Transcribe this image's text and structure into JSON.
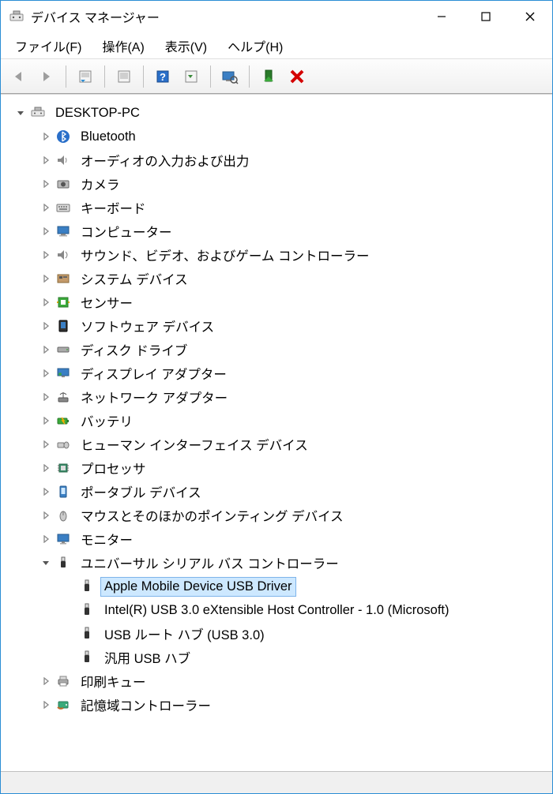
{
  "window": {
    "title": "デバイス マネージャー"
  },
  "menu": {
    "file": "ファイル(F)",
    "action": "操作(A)",
    "view": "表示(V)",
    "help": "ヘルプ(H)"
  },
  "toolbar": {
    "back": "back",
    "forward": "forward",
    "properties1": "properties",
    "properties2": "properties",
    "help": "help",
    "show_hidden": "show-hidden",
    "scan": "scan-hardware",
    "install": "add-hardware",
    "remove": "remove"
  },
  "tree": {
    "root": "DESKTOP-PC",
    "categories": [
      {
        "label": "Bluetooth",
        "icon": "bluetooth"
      },
      {
        "label": "オーディオの入力および出力",
        "icon": "audio"
      },
      {
        "label": "カメラ",
        "icon": "camera"
      },
      {
        "label": "キーボード",
        "icon": "keyboard"
      },
      {
        "label": "コンピューター",
        "icon": "computer"
      },
      {
        "label": "サウンド、ビデオ、およびゲーム コントローラー",
        "icon": "sound"
      },
      {
        "label": "システム デバイス",
        "icon": "system"
      },
      {
        "label": "センサー",
        "icon": "sensor"
      },
      {
        "label": "ソフトウェア デバイス",
        "icon": "software"
      },
      {
        "label": "ディスク ドライブ",
        "icon": "disk"
      },
      {
        "label": "ディスプレイ アダプター",
        "icon": "display"
      },
      {
        "label": "ネットワーク アダプター",
        "icon": "network"
      },
      {
        "label": "バッテリ",
        "icon": "battery"
      },
      {
        "label": "ヒューマン インターフェイス デバイス",
        "icon": "hid"
      },
      {
        "label": "プロセッサ",
        "icon": "cpu"
      },
      {
        "label": "ポータブル デバイス",
        "icon": "portable"
      },
      {
        "label": "マウスとそのほかのポインティング デバイス",
        "icon": "mouse"
      },
      {
        "label": "モニター",
        "icon": "monitor"
      }
    ],
    "usb_category": {
      "label": "ユニバーサル シリアル バス コントローラー",
      "icon": "usb"
    },
    "usb_children": [
      {
        "label": "Apple Mobile Device USB Driver",
        "selected": true
      },
      {
        "label": "Intel(R) USB 3.0 eXtensible Host Controller - 1.0 (Microsoft)",
        "selected": false
      },
      {
        "label": "USB ルート ハブ (USB 3.0)",
        "selected": false
      },
      {
        "label": "汎用 USB ハブ",
        "selected": false
      }
    ],
    "after_usb": [
      {
        "label": "印刷キュー",
        "icon": "printer"
      },
      {
        "label": "記憶域コントローラー",
        "icon": "storage"
      }
    ]
  }
}
